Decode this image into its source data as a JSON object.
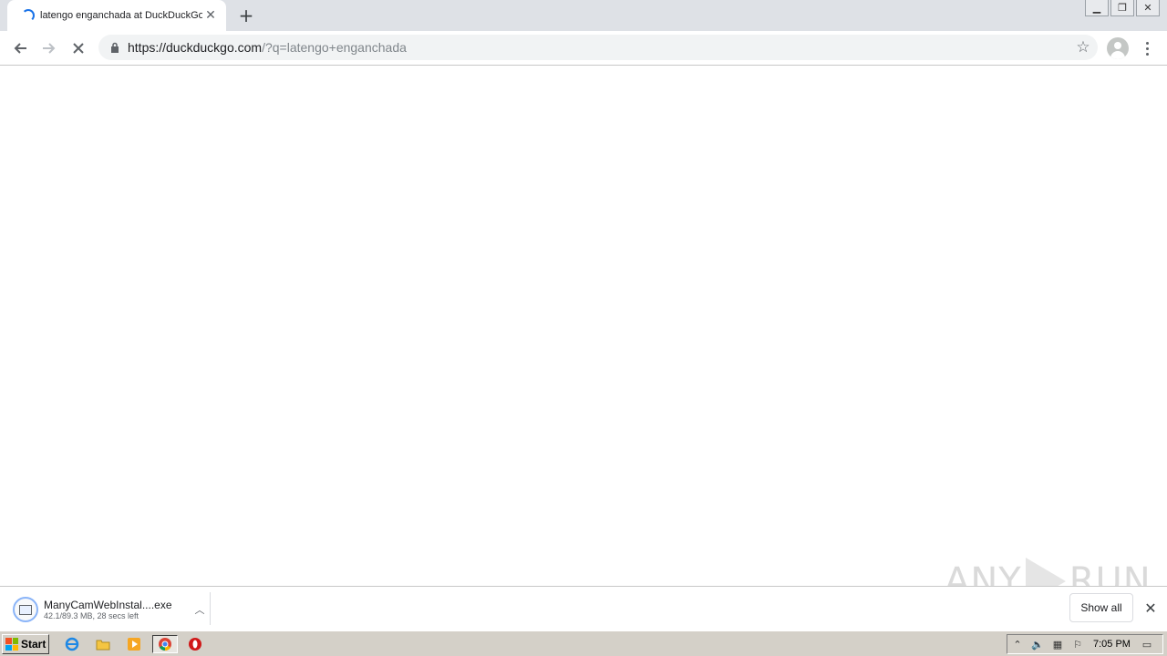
{
  "browser": {
    "tab": {
      "title": "latengo enganchada at DuckDuckGo",
      "loading": true
    },
    "new_tab_label": "+",
    "window_controls": [
      "minimize",
      "restore",
      "close"
    ],
    "address": {
      "scheme_host": "https://duckduckgo.com",
      "path_query": "/?q=latengo+enganchada"
    }
  },
  "download": {
    "filename": "ManyCamWebInstal....exe",
    "status": "42.1/89.3 MB, 28 secs left",
    "show_all_label": "Show all"
  },
  "watermark": {
    "left": "ANY",
    "right": "RUN"
  },
  "taskbar": {
    "start_label": "Start",
    "pinned": [
      "internet-explorer-icon",
      "folder-icon",
      "media-player-icon",
      "chrome-icon",
      "opera-icon"
    ],
    "clock": "7:05 PM"
  },
  "colors": {
    "accent": "#1a73e8",
    "chrome_frame": "#dee1e6",
    "taskbar": "#d4d0c8"
  }
}
